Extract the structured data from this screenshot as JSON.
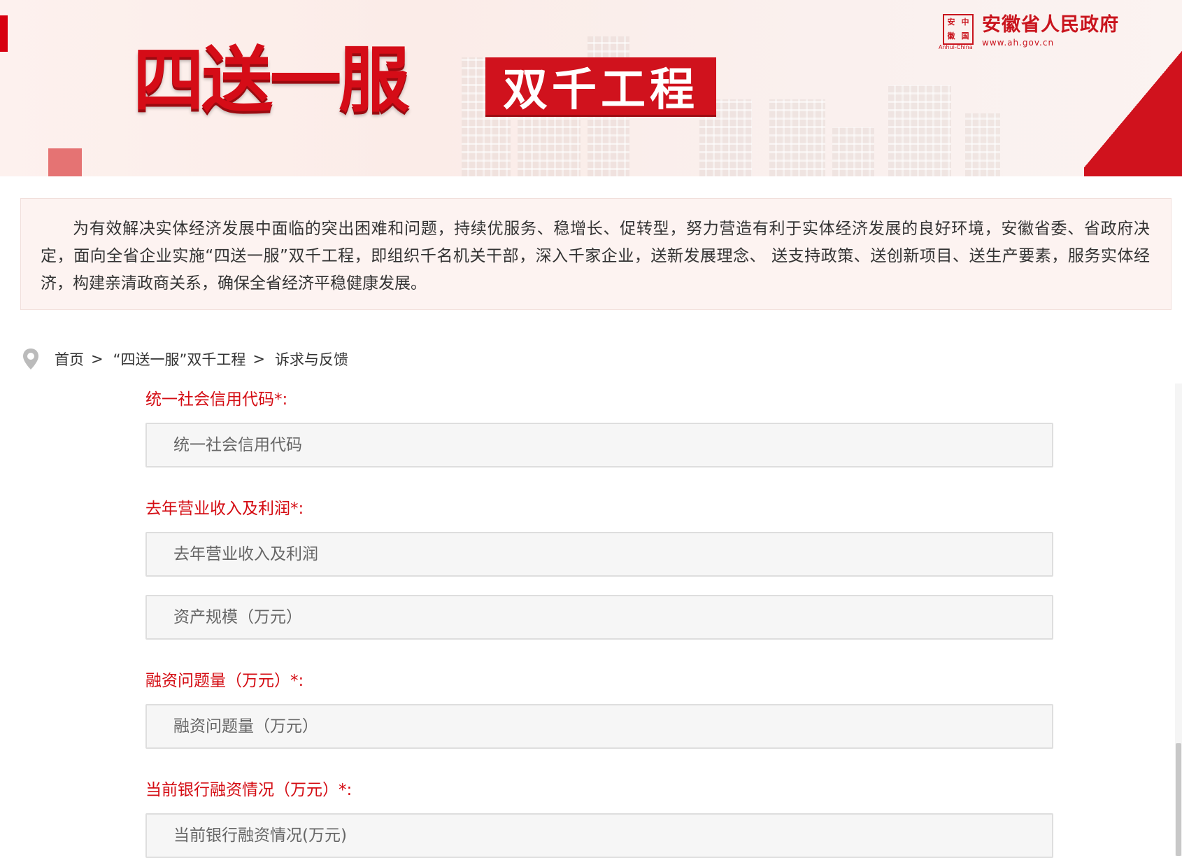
{
  "banner": {
    "title": "四送一服",
    "subtitle": "双千工程",
    "logo": {
      "seal": [
        "安",
        "中",
        "徽",
        "国"
      ],
      "seal_caption": "Anhui-China",
      "site_name": "安徽省人民政府",
      "site_url": "www.ah.gov.cn"
    }
  },
  "intro": {
    "text": "为有效解决实体经济发展中面临的突出困难和问题，持续优服务、稳增长、促转型，努力营造有利于实体经济发展的良好环境，安徽省委、省政府决定，面向全省企业实施“四送一服”双千工程，即组织千名机关干部，深入千家企业，送新发展理念、 送支持政策、送创新项目、送生产要素，服务实体经济，构建亲清政商关系，确保全省经济平稳健康发展。"
  },
  "breadcrumb": {
    "home": "首页",
    "section": "“四送一服”双千工程",
    "current": "诉求与反馈",
    "separator": ">"
  },
  "form": {
    "credit_code_label": "统一社会信用代码*:",
    "credit_code_placeholder": "统一社会信用代码",
    "revenue_label": "去年营业收入及利润*:",
    "revenue_placeholder": "去年营业收入及利润",
    "assets_placeholder": "资产规模（万元）",
    "financing_label": "融资问题量（万元）*:",
    "financing_placeholder": "融资问题量（万元）",
    "bank_label": "当前银行融资情况（万元）*:",
    "bank_placeholder": "当前银行融资情况(万元)"
  },
  "colors": {
    "brand_red": "#d50c17",
    "label_red": "#d40c13",
    "intro_bg": "#fdf3f1"
  }
}
